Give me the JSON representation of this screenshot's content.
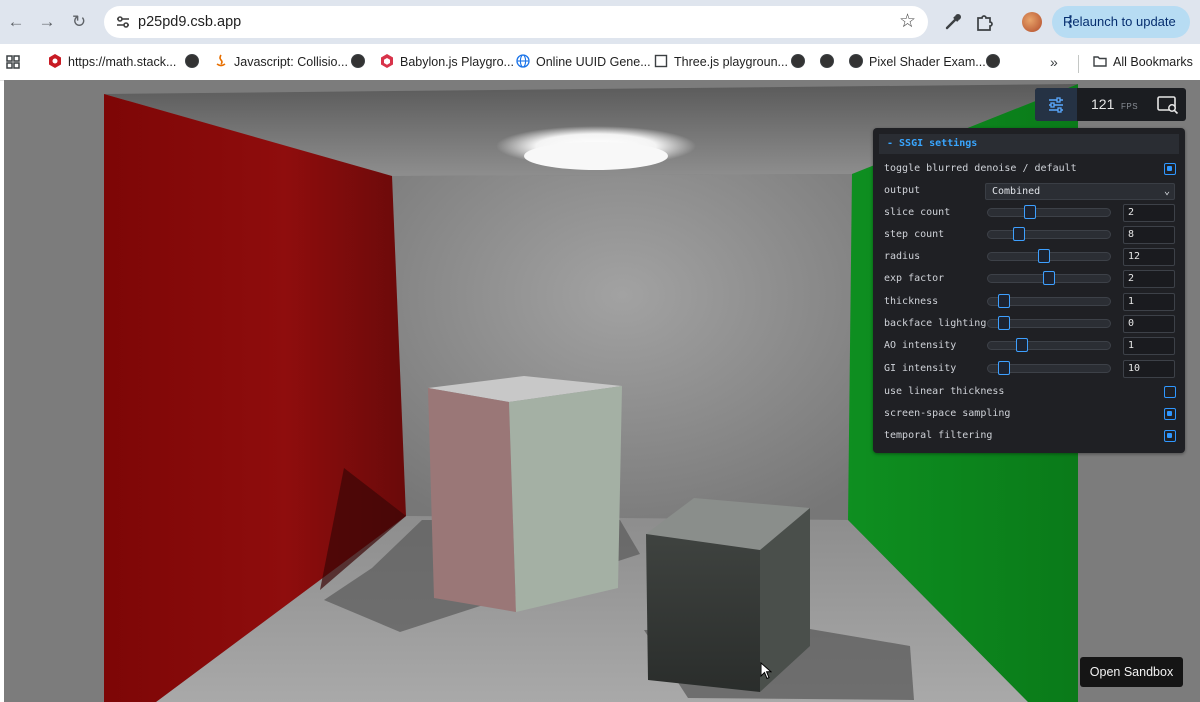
{
  "browser": {
    "url": "p25pd9.csb.app",
    "relaunch_label": "Relaunch to update",
    "bookmarks": [
      {
        "label": "https://math.stack...",
        "icon": "stackexchange-icon"
      },
      {
        "label": "",
        "icon": "globe-icon"
      },
      {
        "label": "Javascript: Collisio...",
        "icon": "java-icon"
      },
      {
        "label": "",
        "icon": "globe-icon"
      },
      {
        "label": "Babylon.js Playgro...",
        "icon": "babylon-icon"
      },
      {
        "label": "Online UUID Gene...",
        "icon": "web-icon"
      },
      {
        "label": "Three.js playgroun...",
        "icon": "page-icon"
      },
      {
        "label": "",
        "icon": "globe-icon"
      },
      {
        "label": "",
        "icon": "globe-icon"
      },
      {
        "label": "Pixel Shader Exam...",
        "icon": "globe-icon"
      },
      {
        "label": "",
        "icon": "globe-icon"
      }
    ],
    "more_label": "»",
    "all_bookmarks_label": "All Bookmarks"
  },
  "stats": {
    "fps_value": "121",
    "fps_label": "FPS"
  },
  "panel": {
    "title": "- SSGI settings",
    "rows": [
      {
        "label": "toggle blurred denoise / default",
        "type": "checkbox",
        "checked": true
      },
      {
        "label": "output",
        "type": "select",
        "value": "Combined"
      },
      {
        "label": "slice count",
        "type": "slider",
        "value": "2",
        "fraction": 0.35
      },
      {
        "label": "step count",
        "type": "slider",
        "value": "8",
        "fraction": 0.26
      },
      {
        "label": "radius",
        "type": "slider",
        "value": "12",
        "fraction": 0.46
      },
      {
        "label": "exp factor",
        "type": "slider",
        "value": "2",
        "fraction": 0.5
      },
      {
        "label": "thickness",
        "type": "slider",
        "value": "1",
        "fraction": 0.14
      },
      {
        "label": "backface lighting",
        "type": "slider",
        "value": "0",
        "fraction": 0.14
      },
      {
        "label": "AO intensity",
        "type": "slider",
        "value": "1",
        "fraction": 0.28
      },
      {
        "label": "GI intensity",
        "type": "slider",
        "value": "10",
        "fraction": 0.14
      },
      {
        "label": "use linear thickness",
        "type": "checkbox",
        "checked": false
      },
      {
        "label": "screen-space sampling",
        "type": "checkbox",
        "checked": true
      },
      {
        "label": "temporal filtering",
        "type": "checkbox",
        "checked": true
      }
    ]
  },
  "open_sandbox_label": "Open Sandbox",
  "colors": {
    "accent": "#2f97ff",
    "red_wall": "#8a0a0a",
    "green_wall": "#0c8a1e"
  }
}
